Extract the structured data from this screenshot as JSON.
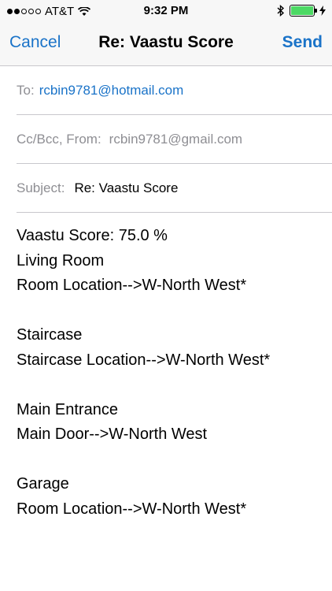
{
  "status": {
    "carrier": "AT&T",
    "time": "9:32 PM"
  },
  "nav": {
    "cancel": "Cancel",
    "title": "Re: Vaastu Score",
    "send": "Send"
  },
  "fields": {
    "to_label": "To:",
    "to_value": "rcbin9781@hotmail.com",
    "ccbcc_label": "Cc/Bcc, From:",
    "from_value": "rcbin9781@gmail.com",
    "subject_label": "Subject:",
    "subject_value": "Re: Vaastu Score"
  },
  "body": {
    "lines": [
      "Vaastu Score: 75.0 %",
      "Living Room",
      "Room Location-->W-North West*",
      "",
      "Staircase",
      "Staircase Location-->W-North West*",
      "",
      "Main Entrance",
      "Main Door-->W-North West",
      "",
      "Garage",
      "Room Location-->W-North West*"
    ]
  },
  "colors": {
    "accent": "#1a73c8",
    "battery": "#4cd964",
    "label_gray": "#8e8e93"
  }
}
